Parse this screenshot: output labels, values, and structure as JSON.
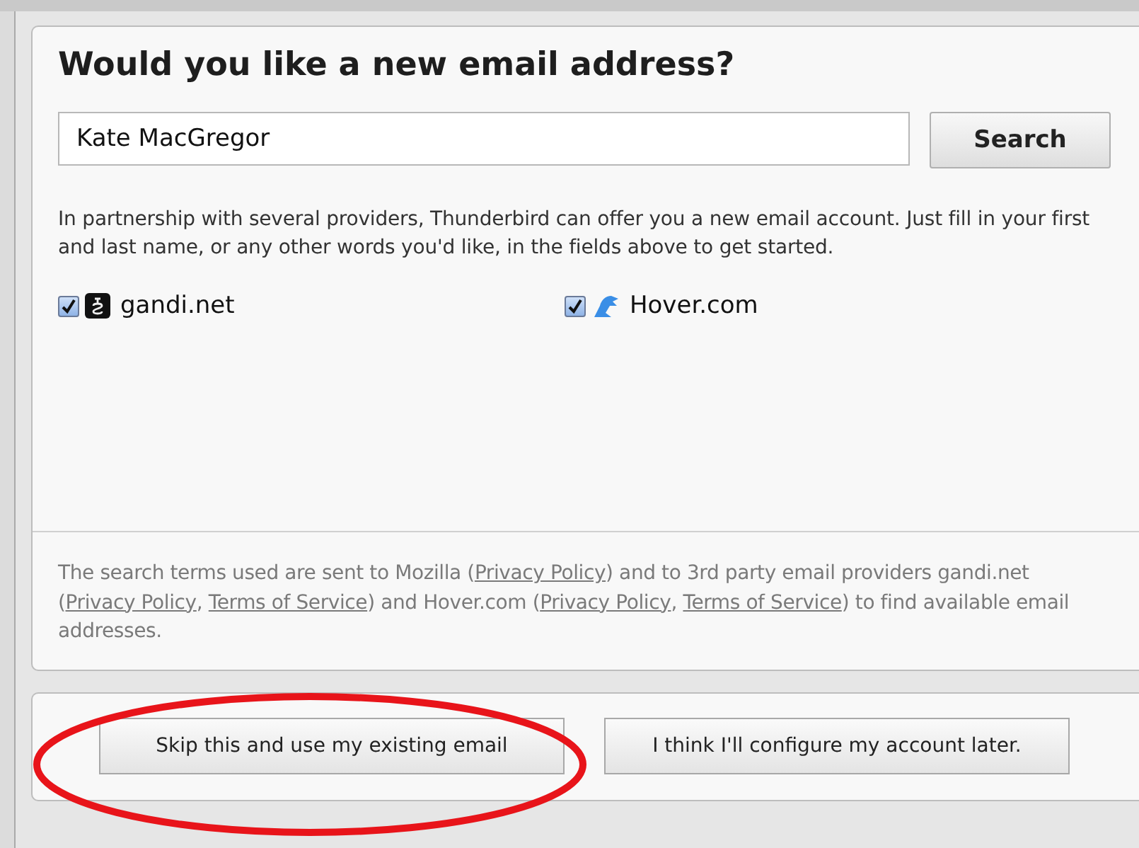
{
  "heading": "Would you like a new email address?",
  "search": {
    "value": "Kate MacGregor",
    "button": "Search"
  },
  "description": "In partnership with several providers, Thunderbird can offer you a new email account. Just fill in your first and last name, or any other words you'd like, in the fields above to get started.",
  "providers": [
    {
      "name": "gandi.net",
      "checked": true,
      "kind": "gandi"
    },
    {
      "name": "Hover.com",
      "checked": true,
      "kind": "hover"
    }
  ],
  "footer": [
    {
      "kind": "text",
      "text": "The search terms used are sent to Mozilla ("
    },
    {
      "kind": "link",
      "text": "Privacy Policy"
    },
    {
      "kind": "text",
      "text": ") and to 3rd party email providers gandi.net ("
    },
    {
      "kind": "link",
      "text": "Privacy Policy"
    },
    {
      "kind": "text",
      "text": ", "
    },
    {
      "kind": "link",
      "text": "Terms of Service"
    },
    {
      "kind": "text",
      "text": ") and Hover.com ("
    },
    {
      "kind": "link",
      "text": "Privacy Policy"
    },
    {
      "kind": "text",
      "text": ", "
    },
    {
      "kind": "link",
      "text": "Terms of Service"
    },
    {
      "kind": "text",
      "text": ") to find available email addresses."
    }
  ],
  "buttons": [
    {
      "label": "Skip this and use my existing email",
      "highlighted": true
    },
    {
      "label": "I think I'll configure my account later.",
      "highlighted": false
    }
  ]
}
